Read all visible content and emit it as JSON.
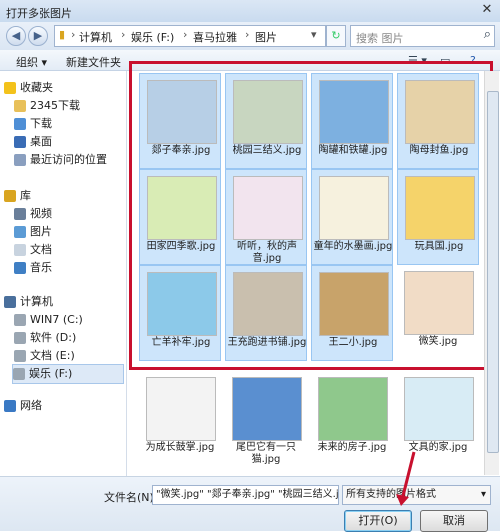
{
  "window": {
    "title": "打开多张图片"
  },
  "breadcrumb": [
    "计算机",
    "娱乐 (F:)",
    "喜马拉雅",
    "图片"
  ],
  "search": {
    "placeholder": "搜索 图片"
  },
  "toolbar": {
    "organize": "组织 ▾",
    "new_folder": "新建文件夹"
  },
  "sidebar": {
    "favorites_label": "收藏夹",
    "favorites": [
      "2345下载",
      "下载",
      "桌面",
      "最近访问的位置"
    ],
    "library_label": "库",
    "libraries": [
      "视频",
      "图片",
      "文档",
      "音乐"
    ],
    "computer_label": "计算机",
    "drives": [
      "WIN7 (C:)",
      "软件 (D:)",
      "文档 (E:)",
      "娱乐 (F:)"
    ],
    "network_label": "网络"
  },
  "files": [
    {
      "name": "郯子奉亲.jpg",
      "selected": true,
      "color": "#b7cfe6"
    },
    {
      "name": "桃园三结义.jpg",
      "selected": true,
      "color": "#c8d6c0"
    },
    {
      "name": "陶罐和铁罐.jpg",
      "selected": true,
      "color": "#7db0e0"
    },
    {
      "name": "陶母封鱼.jpg",
      "selected": true,
      "color": "#e6d2a8"
    },
    {
      "name": "田家四季歌.jpg",
      "selected": true,
      "color": "#d9ecb5"
    },
    {
      "name": "听听，秋的声音.jpg",
      "selected": true,
      "color": "#f2e4ee"
    },
    {
      "name": "童年的水墨画.jpg",
      "selected": true,
      "color": "#f6f1de"
    },
    {
      "name": "玩具国.jpg",
      "selected": true,
      "color": "#f5d36a"
    },
    {
      "name": "亡羊补牢.jpg",
      "selected": true,
      "color": "#8cc9e9"
    },
    {
      "name": "王充跑进书铺.jpg",
      "selected": true,
      "color": "#c9bfae"
    },
    {
      "name": "王二小.jpg",
      "selected": true,
      "color": "#c8a36a"
    },
    {
      "name": "微笑.jpg",
      "selected": false,
      "color": "#f1dcc6"
    },
    {
      "name": "为成长鼓掌.jpg",
      "selected": false,
      "color": "#f3f3f3"
    },
    {
      "name": "尾巴它有一只猫.jpg",
      "selected": false,
      "color": "#5a8fd0"
    },
    {
      "name": "未来的房子.jpg",
      "selected": false,
      "color": "#8fc88c"
    },
    {
      "name": "文具的家.jpg",
      "selected": false,
      "color": "#d8ecf5"
    }
  ],
  "bottom": {
    "filename_label": "文件名(N):",
    "filename_value": "\"微笑.jpg\" \"郯子奉亲.jpg\" \"桃园三结义.jpg\"",
    "filetype": "所有支持的图片格式",
    "open": "打开(O)",
    "cancel": "取消"
  },
  "colors": {
    "highlight": "#c8102e"
  }
}
